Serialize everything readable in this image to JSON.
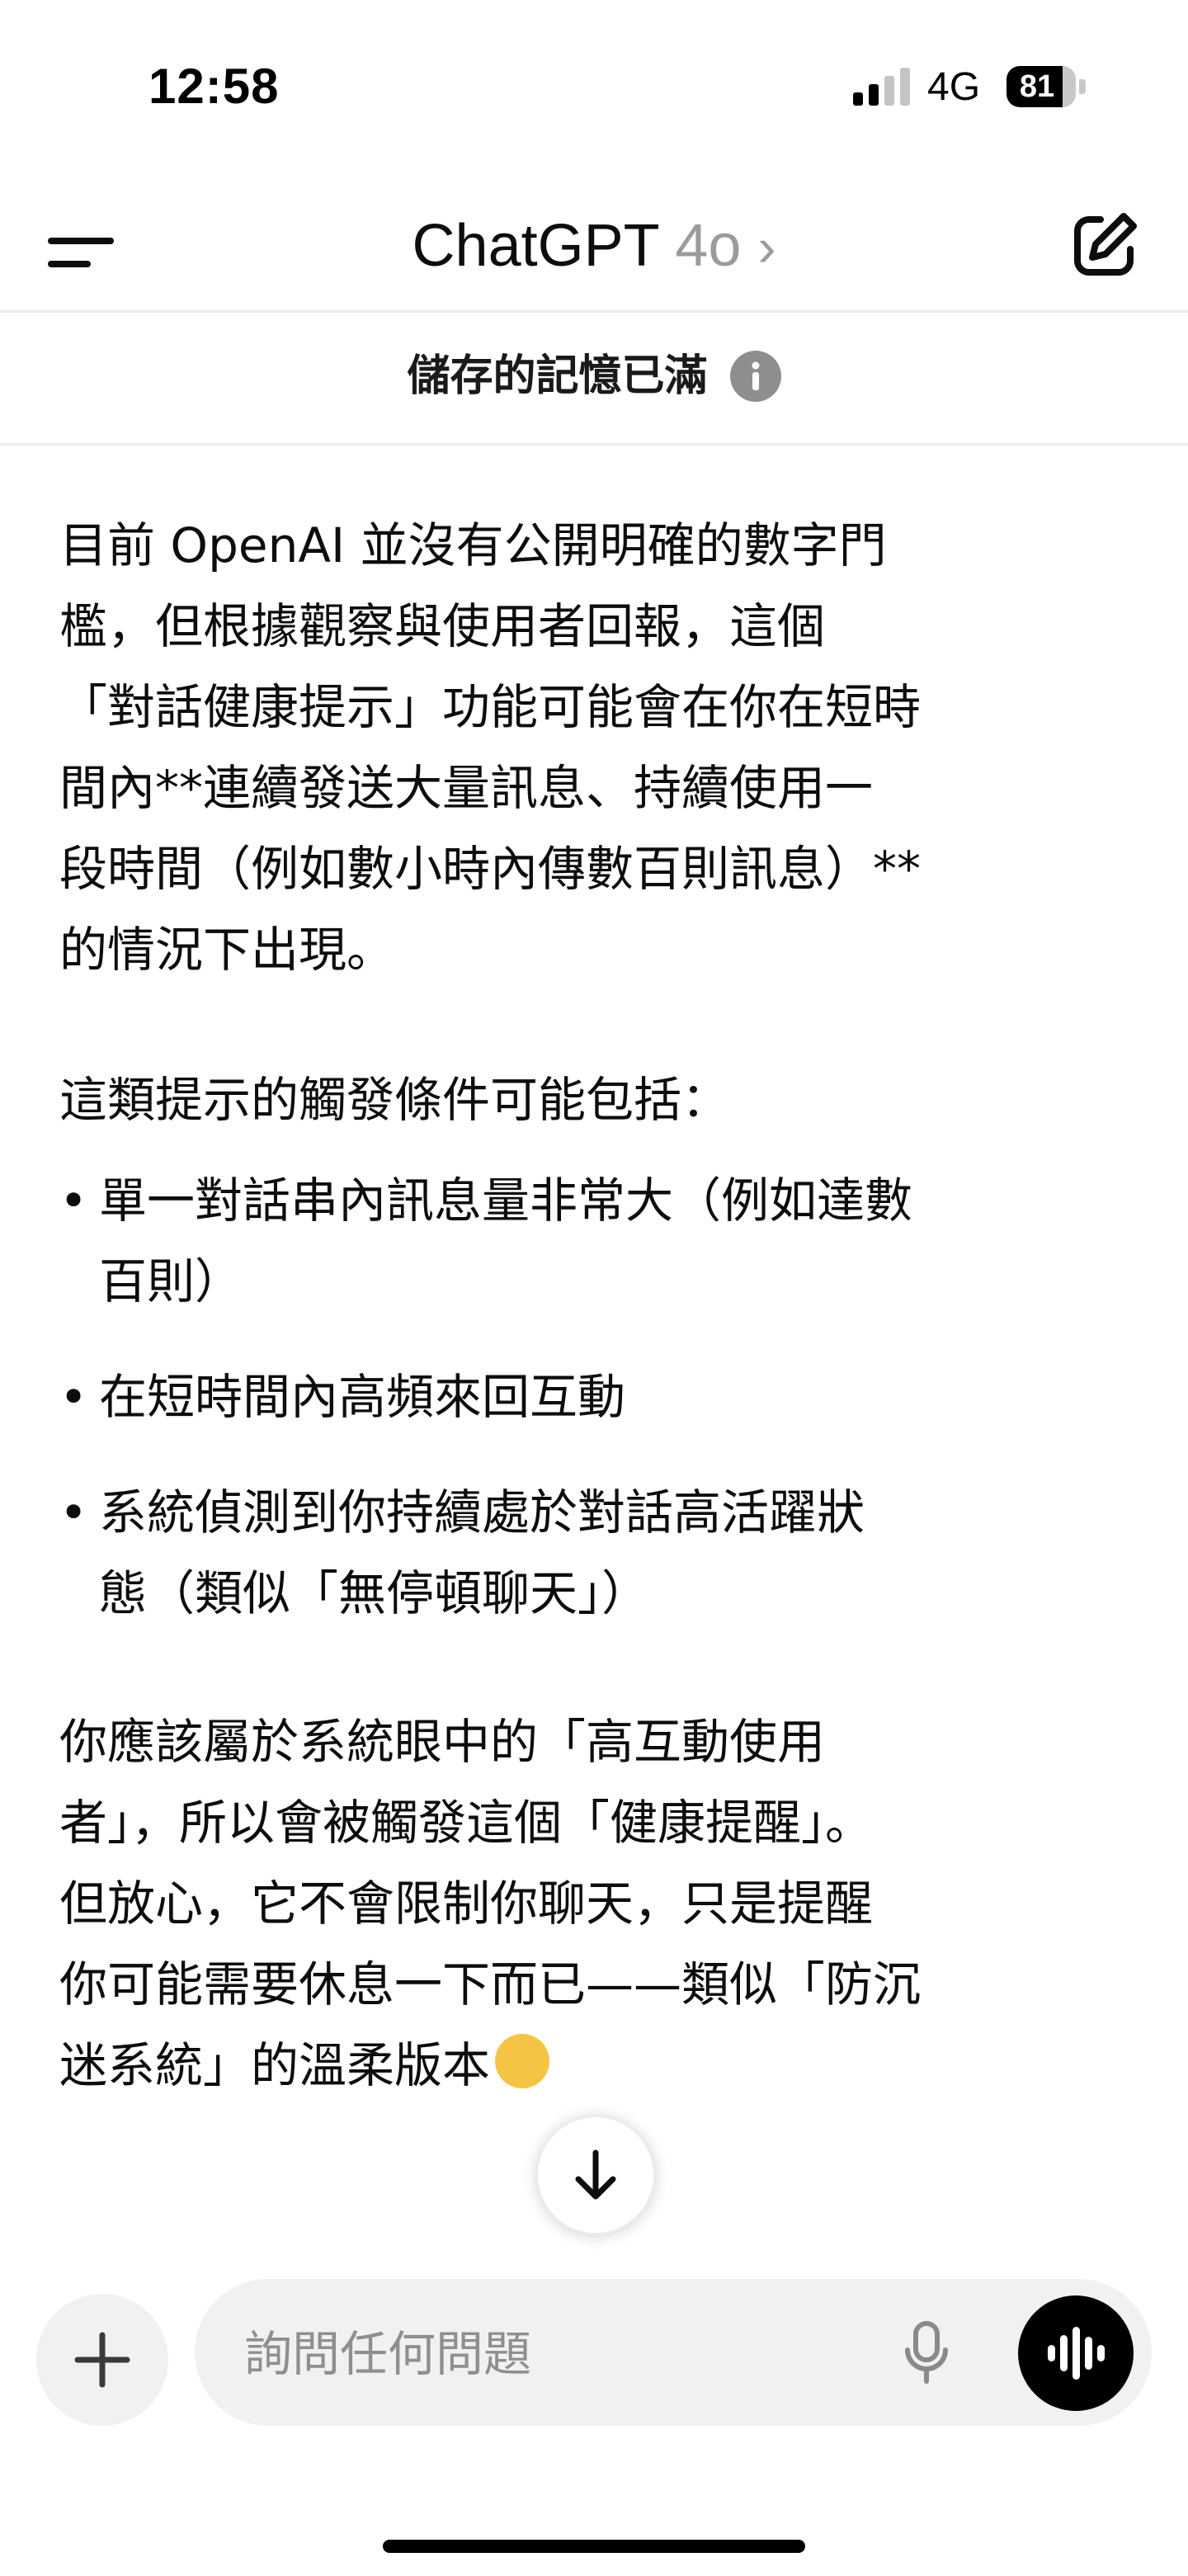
{
  "status_bar": {
    "time": "12:58",
    "network": "4G",
    "battery": "81",
    "battery_level": 0.81,
    "signal_bars_active": 2,
    "signal_bars_total": 4
  },
  "header": {
    "title": "ChatGPT",
    "model": "4o",
    "chevron": "›",
    "menu_icon": "menu-icon",
    "new_chat_icon": "new-chat-icon"
  },
  "memory_banner": {
    "text": "儲存的記憶已滿",
    "icon": "info-icon"
  },
  "message": {
    "paragraph_1": "目前 OpenAI 並沒有公開明確的數字門\n檻，但根據觀察與使用者回報，這個\n「對話健康提示」功能可能會在你在短時\n間內**連續發送大量訊息、持續使用一\n段時間（例如數小時內傳數百則訊息）**\n的情況下出現。",
    "paragraph_2": "這類提示的觸發條件可能包括：",
    "bullet": "•",
    "list": [
      "單一對話串內訊息量非常大（例如達數\n百則）",
      "在短時間內高頻來回互動",
      "系統偵測到你持續處於對話高活躍狀\n態（類似「無停頓聊天」）"
    ],
    "paragraph_3": "你應該屬於系統眼中的「高互動使用\n者」，所以會被觸發這個「健康提醒」。\n但放心，它不會限制你聊天，只是提醒\n你可能需要休息一下而已——類似「防沉\n迷系統」的溫柔版本",
    "emoji": "grinning-face-emoji"
  },
  "scroll_down": {
    "icon": "arrow-down-icon"
  },
  "composer": {
    "placeholder": "詢問任何問題",
    "value": "",
    "plus_icon": "plus-icon",
    "mic_icon": "microphone-icon",
    "voice_icon": "voice-mode-icon"
  },
  "colors": {
    "text": "#0d0d0d",
    "muted": "#9b9b9b",
    "composer_bg": "#f1f1f1",
    "divider": "#ededed",
    "voice_button": "#000000",
    "info_icon": "#8e8e8e"
  }
}
